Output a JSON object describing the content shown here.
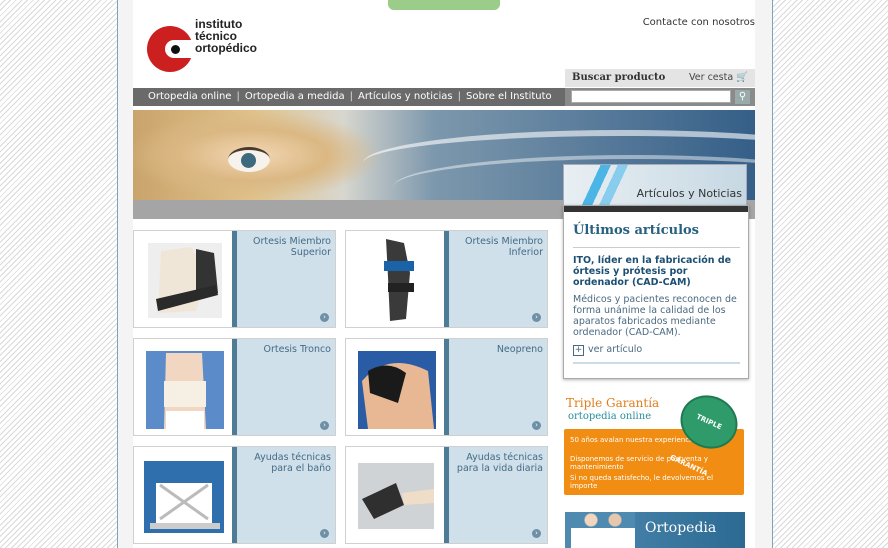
{
  "brand": {
    "line1": "instituto",
    "line2": "técnico",
    "line3": "ortopédico",
    "red": "#cc1f1f"
  },
  "header": {
    "contact": "Contacte con nosotros"
  },
  "search": {
    "label": "Buscar producto",
    "cart": "Ver cesta 🛒",
    "button_icon": "search-icon",
    "placeholder": ""
  },
  "nav": {
    "items": [
      "Ortopedia online",
      "Ortopedia a medida",
      "Artículos y noticias",
      "Sobre el Instituto"
    ]
  },
  "news": {
    "tab_title": "Artículos y Noticias",
    "heading": "Últimos artículos",
    "article_title": "ITO, líder en la fabricación de órtesis y prótesis por ordenador (CAD-CAM)",
    "article_desc": "Médicos y pacientes reconocen de forma unánime la calidad de los aparatos fabricados mediante ordenador (CAD-CAM).",
    "more": "ver artículo"
  },
  "categories": [
    {
      "label": "Ortesis Miembro Superior"
    },
    {
      "label": "Ortesis Miembro Inferior"
    },
    {
      "label": "Ortesis Tronco"
    },
    {
      "label": "Neopreno"
    },
    {
      "label": "Ayudas técnicas para el baño"
    },
    {
      "label": "Ayudas técnicas para la vida diaria"
    }
  ],
  "guarantee": {
    "title": "Triple Garantía",
    "subtitle": "ortopedia online",
    "seal": "TRIPLE GARANTÍA",
    "points": [
      "50 años avalan nuestra experiencia.",
      "Disponemos de servicio de postventa y mantenimiento",
      "Si no queda satisfecho, le devolvemos el importe"
    ]
  },
  "promo": {
    "text": "Ortopedia"
  },
  "colors": {
    "accent": "#286080",
    "panel": "#cfe0ea",
    "orange": "#f08d12"
  }
}
